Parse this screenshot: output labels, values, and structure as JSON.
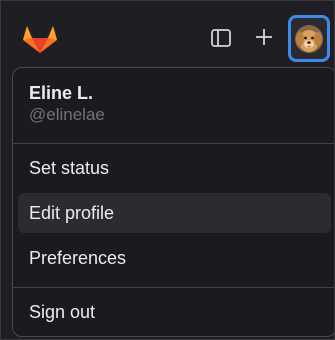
{
  "topbar": {
    "logo_icon": "gitlab-tanuki-icon",
    "sidebar_toggle_icon": "sidebar-panel-icon",
    "new_icon": "plus-icon",
    "avatar_icon": "user-avatar-dog",
    "avatar_ring_color": "#3d8be8"
  },
  "user_menu": {
    "name": "Eline L.",
    "handle": "@elinelae",
    "items": [
      {
        "label": "Set status"
      },
      {
        "label": "Edit profile",
        "highlighted": true
      },
      {
        "label": "Preferences"
      },
      {
        "label": "Sign out"
      }
    ]
  },
  "colors": {
    "logo_orange": "#fc6d26",
    "logo_red": "#e24329",
    "logo_light": "#fca326"
  }
}
